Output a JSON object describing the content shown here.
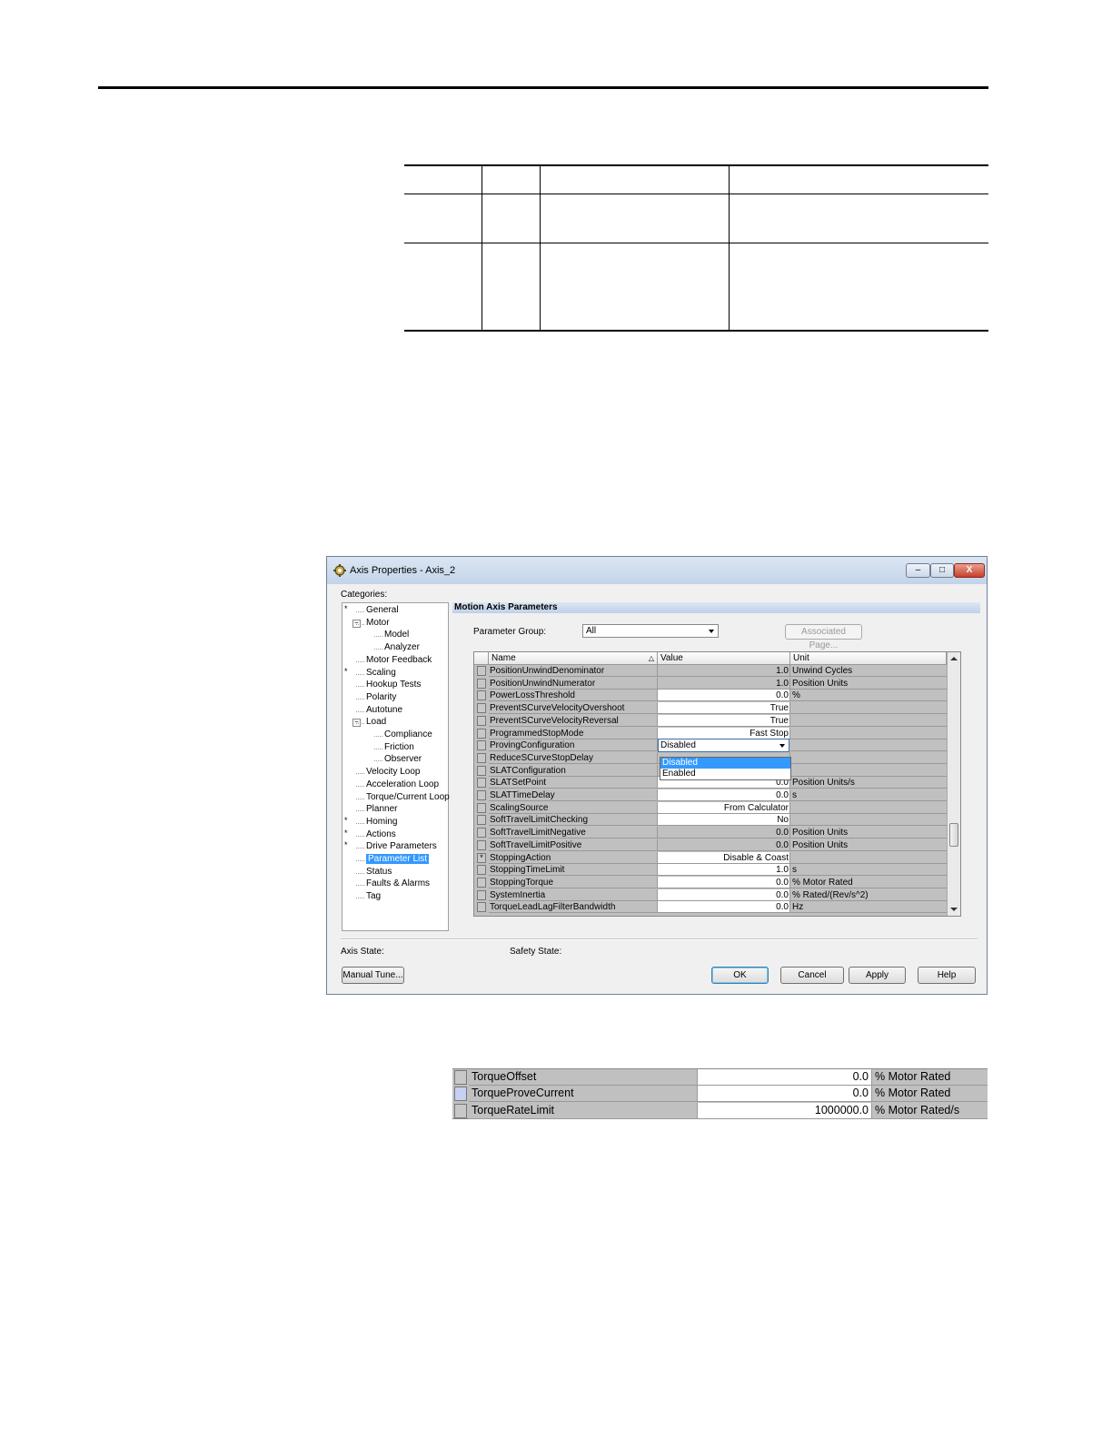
{
  "window": {
    "title": "Axis Properties - Axis_2",
    "categories_label": "Categories:",
    "section_title": "Motion Axis Parameters",
    "parameter_group_label": "Parameter Group:",
    "parameter_group_value": "All",
    "associated_page_label": "Associated Page...",
    "axis_state_label": "Axis State:",
    "safety_state_label": "Safety State:",
    "buttons": {
      "manual_tune": "Manual Tune...",
      "ok": "OK",
      "cancel": "Cancel",
      "apply": "Apply",
      "help": "Help",
      "minimize": "–",
      "maximize": "□",
      "close": "X"
    }
  },
  "tree": [
    {
      "label": "General",
      "level": 0,
      "star": true
    },
    {
      "label": "Motor",
      "level": 0,
      "expander": "−"
    },
    {
      "label": "Model",
      "level": 1
    },
    {
      "label": "Analyzer",
      "level": 1
    },
    {
      "label": "Motor Feedback",
      "level": 0
    },
    {
      "label": "Scaling",
      "level": 0,
      "star": true
    },
    {
      "label": "Hookup Tests",
      "level": 0
    },
    {
      "label": "Polarity",
      "level": 0
    },
    {
      "label": "Autotune",
      "level": 0
    },
    {
      "label": "Load",
      "level": 0,
      "expander": "−"
    },
    {
      "label": "Compliance",
      "level": 1
    },
    {
      "label": "Friction",
      "level": 1
    },
    {
      "label": "Observer",
      "level": 1
    },
    {
      "label": "Velocity Loop",
      "level": 0
    },
    {
      "label": "Acceleration Loop",
      "level": 0
    },
    {
      "label": "Torque/Current Loop",
      "level": 0
    },
    {
      "label": "Planner",
      "level": 0
    },
    {
      "label": "Homing",
      "level": 0,
      "star": true
    },
    {
      "label": "Actions",
      "level": 0,
      "star": true
    },
    {
      "label": "Drive Parameters",
      "level": 0,
      "star": true
    },
    {
      "label": "Parameter List",
      "level": 0,
      "selected": true
    },
    {
      "label": "Status",
      "level": 0
    },
    {
      "label": "Faults & Alarms",
      "level": 0
    },
    {
      "label": "Tag",
      "level": 0
    }
  ],
  "grid": {
    "headers": {
      "name": "Name",
      "sort_icon": "△",
      "value": "Value",
      "unit": "Unit"
    },
    "rows": [
      {
        "name": "PositionUnwindDenominator",
        "value": "1.0",
        "unit": "Unwind Cycles",
        "editable": false
      },
      {
        "name": "PositionUnwindNumerator",
        "value": "1.0",
        "unit": "Position Units",
        "editable": false
      },
      {
        "name": "PowerLossThreshold",
        "value": "0.0",
        "unit": "%",
        "editable": true
      },
      {
        "name": "PreventSCurveVelocityOvershoot",
        "value": "True",
        "unit": "",
        "editable": true
      },
      {
        "name": "PreventSCurveVelocityReversal",
        "value": "True",
        "unit": "",
        "editable": true
      },
      {
        "name": "ProgrammedStopMode",
        "value": "Fast Stop",
        "unit": "",
        "editable": true
      },
      {
        "name": "ProvingConfiguration",
        "value": "Disabled",
        "unit": "",
        "editable": true,
        "combo": true
      },
      {
        "name": "ReduceSCurveStopDelay",
        "value": "",
        "unit": "",
        "editable": false
      },
      {
        "name": "SLATConfiguration",
        "value": "",
        "unit": "",
        "editable": false
      },
      {
        "name": "SLATSetPoint",
        "value": "0.0",
        "unit": "Position Units/s",
        "editable": true
      },
      {
        "name": "SLATTimeDelay",
        "value": "0.0",
        "unit": "s",
        "editable": true
      },
      {
        "name": "ScalingSource",
        "value": "From Calculator",
        "unit": "",
        "editable": true
      },
      {
        "name": "SoftTravelLimitChecking",
        "value": "No",
        "unit": "",
        "editable": true
      },
      {
        "name": "SoftTravelLimitNegative",
        "value": "0.0",
        "unit": "Position Units",
        "editable": false
      },
      {
        "name": "SoftTravelLimitPositive",
        "value": "0.0",
        "unit": "Position Units",
        "editable": false
      },
      {
        "name": "StoppingAction",
        "value": "Disable & Coast",
        "unit": "",
        "editable": true,
        "marker": "*"
      },
      {
        "name": "StoppingTimeLimit",
        "value": "1.0",
        "unit": "s",
        "editable": true
      },
      {
        "name": "StoppingTorque",
        "value": "0.0",
        "unit": "% Motor Rated",
        "editable": true
      },
      {
        "name": "SystemInertia",
        "value": "0.0",
        "unit": "% Rated/(Rev/s^2)",
        "editable": true
      },
      {
        "name": "TorqueLeadLagFilterBandwidth",
        "value": "0.0",
        "unit": "Hz",
        "editable": true
      }
    ],
    "dropdown_options": [
      "Disabled",
      "Enabled"
    ],
    "dropdown_selected": "Disabled"
  },
  "snippet": {
    "rows": [
      {
        "name": "TorqueOffset",
        "value": "0.0",
        "unit": "% Motor Rated"
      },
      {
        "name": "TorqueProveCurrent",
        "value": "0.0",
        "unit": "% Motor Rated"
      },
      {
        "name": "TorqueRateLimit",
        "value": "1000000.0",
        "unit": "% Motor Rated/s"
      }
    ]
  }
}
